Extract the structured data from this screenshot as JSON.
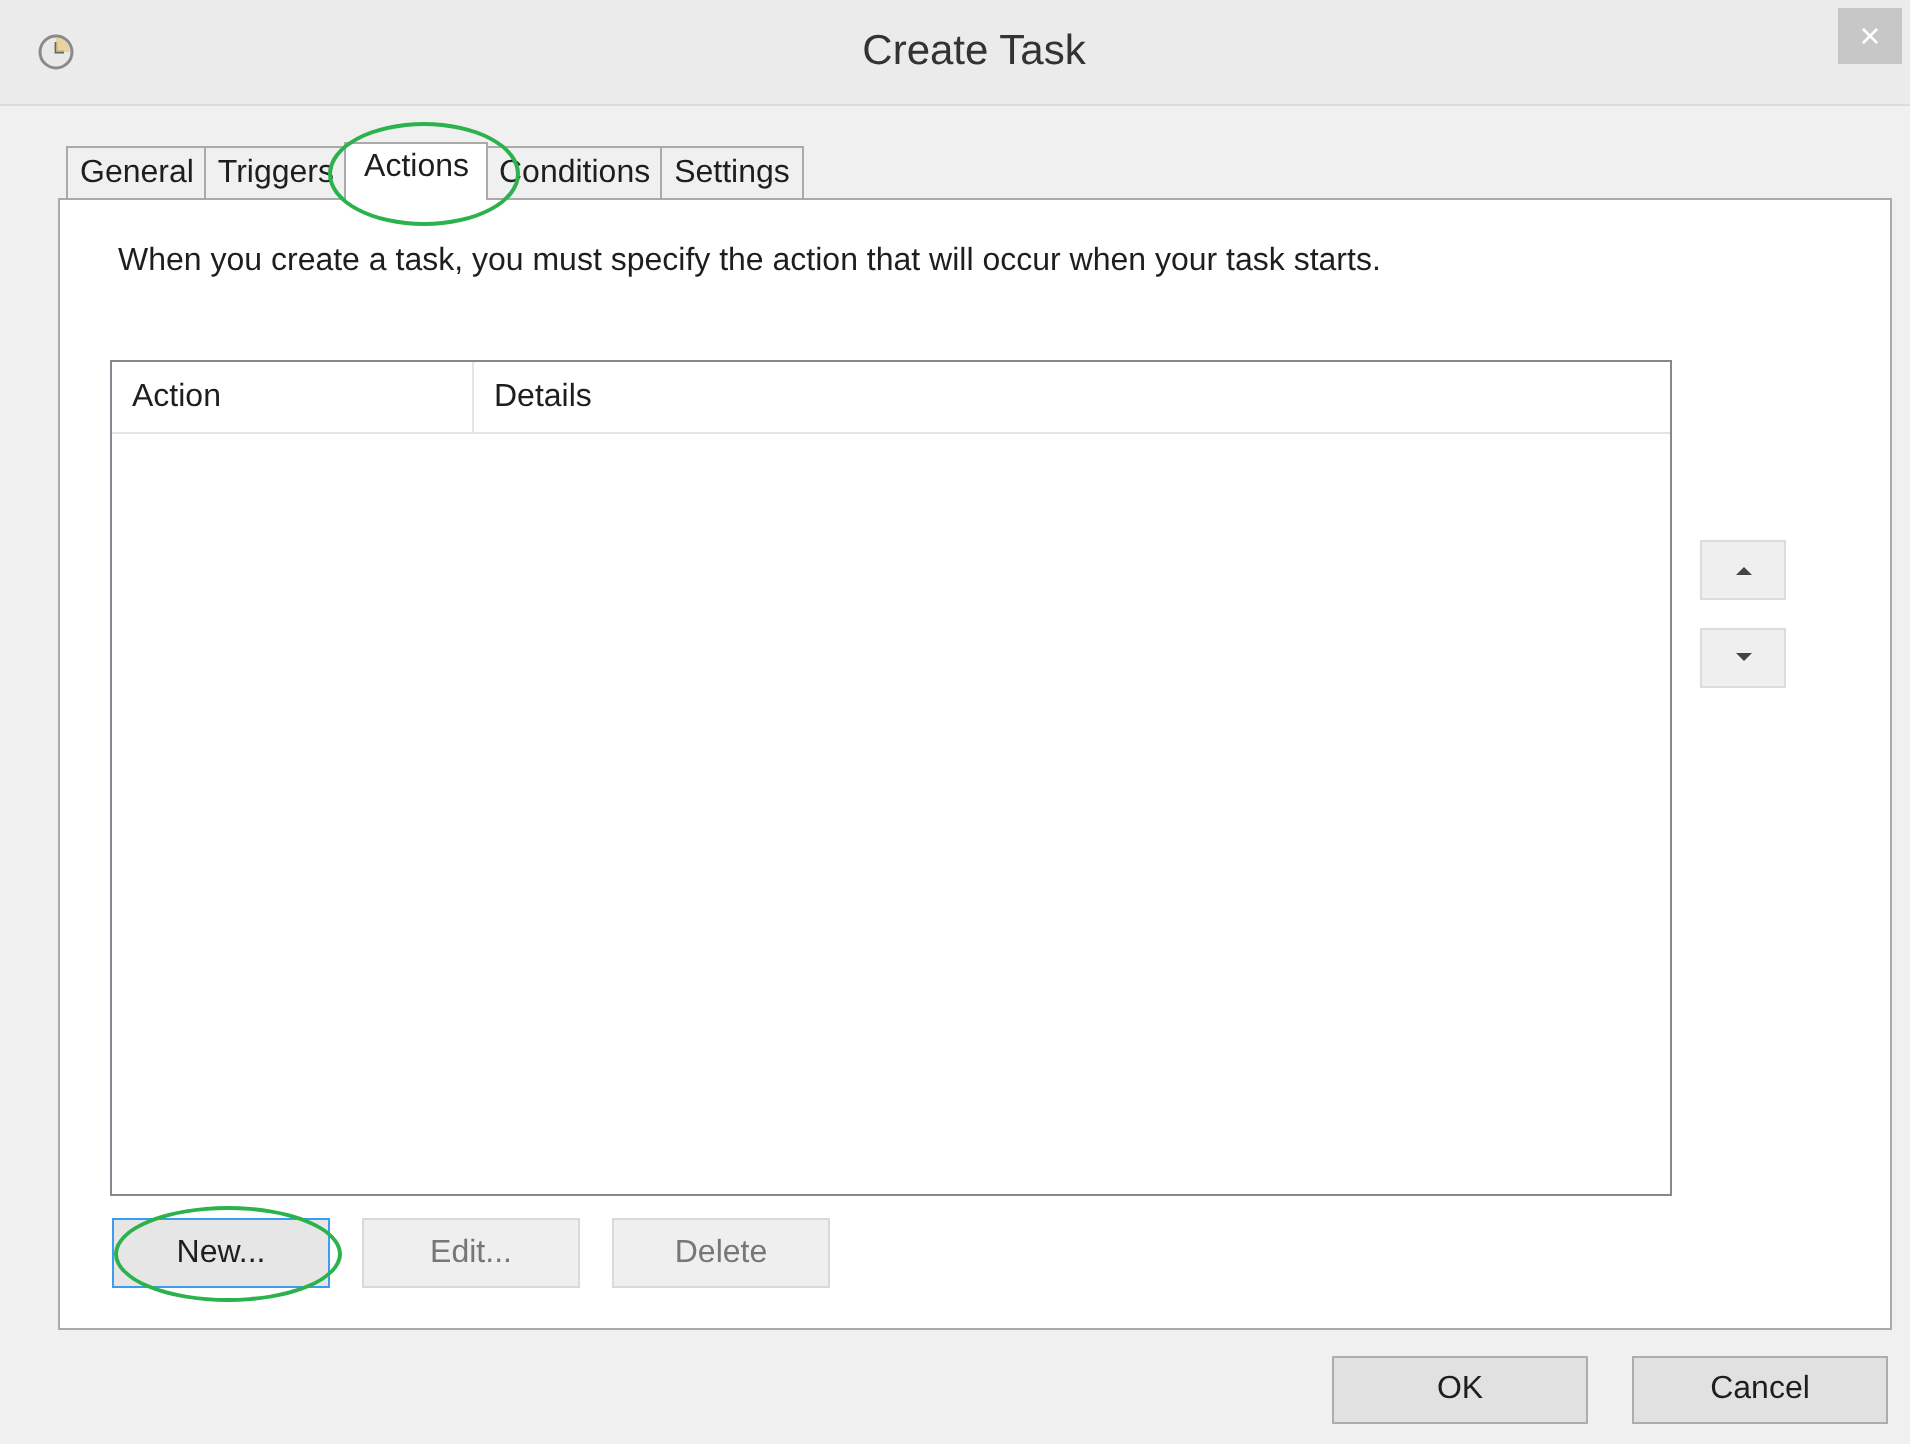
{
  "window": {
    "title": "Create Task",
    "close": "×"
  },
  "tabs": [
    {
      "label": "General",
      "selected": false,
      "circled": false
    },
    {
      "label": "Triggers",
      "selected": false,
      "circled": false
    },
    {
      "label": "Actions",
      "selected": true,
      "circled": true
    },
    {
      "label": "Conditions",
      "selected": false,
      "circled": false
    },
    {
      "label": "Settings",
      "selected": false,
      "circled": false
    }
  ],
  "description": "When you create a task, you must specify the action that will occur when your task starts.",
  "table": {
    "columns": [
      "Action",
      "Details"
    ]
  },
  "action_buttons": [
    {
      "label": "New...",
      "disabled": false,
      "focused": true,
      "circled": true
    },
    {
      "label": "Edit...",
      "disabled": true,
      "focused": false,
      "circled": false
    },
    {
      "label": "Delete",
      "disabled": true,
      "focused": false,
      "circled": false
    }
  ],
  "dialog_buttons": [
    "OK",
    "Cancel"
  ]
}
